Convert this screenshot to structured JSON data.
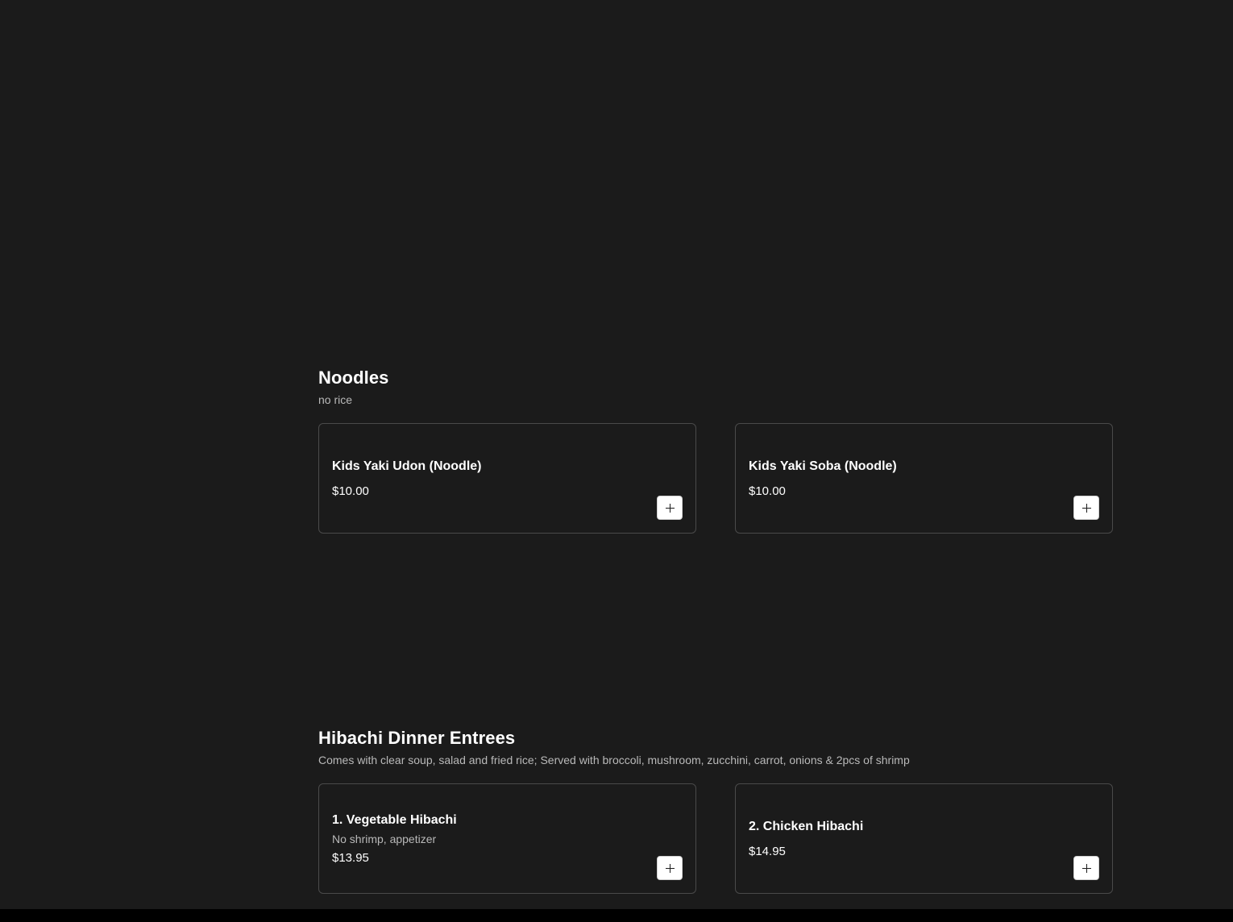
{
  "sections": [
    {
      "title": "Noodles",
      "description": "no rice",
      "items": [
        {
          "name": "Kids Yaki Udon (Noodle)",
          "description": "",
          "price": "$10.00",
          "add_icon": "plus-icon"
        },
        {
          "name": "Kids Yaki Soba (Noodle)",
          "description": "",
          "price": "$10.00",
          "add_icon": "plus-icon"
        }
      ]
    },
    {
      "title": "Hibachi Dinner Entrees",
      "description": "Comes with clear soup, salad and fried rice; Served with broccoli, mushroom, zucchini, carrot, onions & 2pcs of shrimp",
      "items": [
        {
          "name": "1. Vegetable Hibachi",
          "description": "No shrimp, appetizer",
          "price": "$13.95",
          "add_icon": "plus-icon"
        },
        {
          "name": "2. Chicken Hibachi",
          "description": "",
          "price": "$14.95",
          "add_icon": "plus-icon"
        }
      ]
    }
  ],
  "colors": {
    "background": "#1b1b1b",
    "text": "#ffffff",
    "muted_text": "#b9b9b9",
    "card_border": "#4a4a4a",
    "add_button_bg": "#ffffff"
  }
}
